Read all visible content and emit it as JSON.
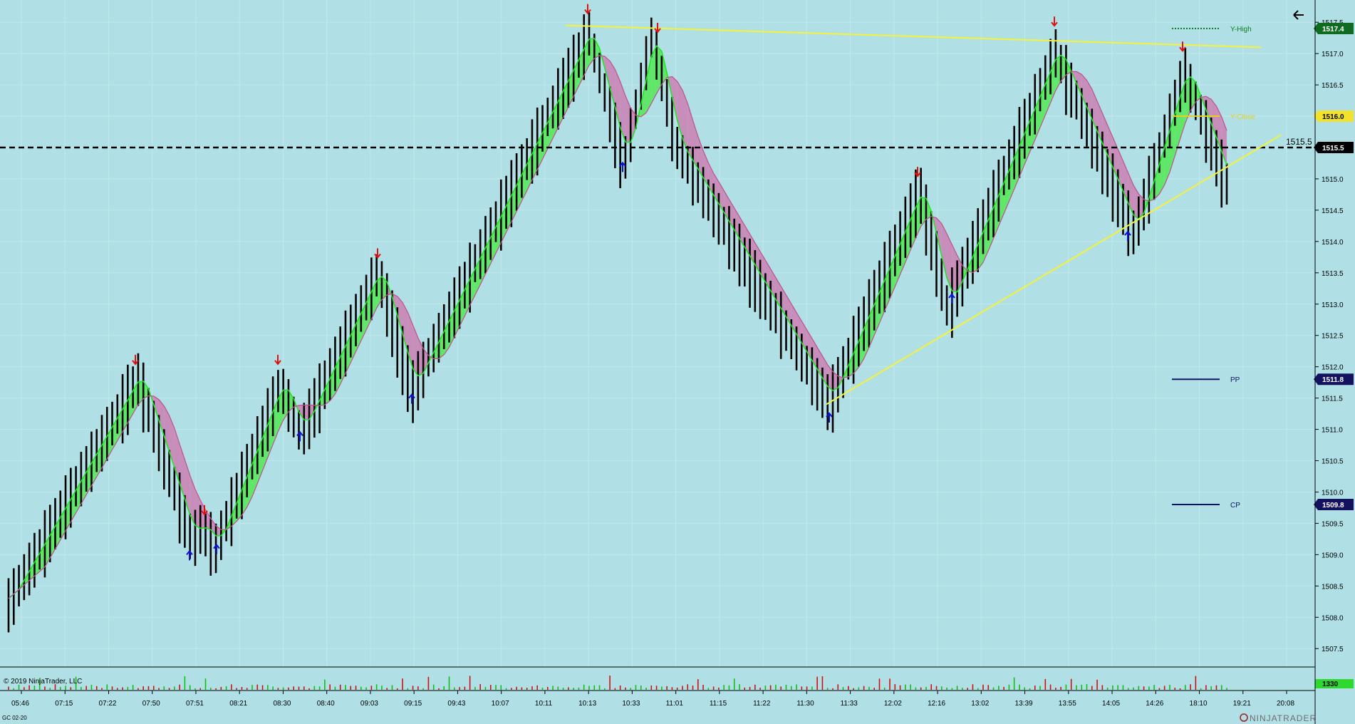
{
  "chart_data": {
    "type": "candlestick",
    "instrument": "GC 02-20",
    "copyright": "© 2019 NinjaTrader, LLC",
    "brand": "NINJATRADER",
    "ylim": [
      1507.2,
      1517.6
    ],
    "y_ticks": [
      "1507.5",
      "1508.0",
      "1508.5",
      "1509.0",
      "1509.5",
      "1510.0",
      "1510.5",
      "1511.0",
      "1511.5",
      "1512.0",
      "1512.5",
      "1513.0",
      "1513.5",
      "1514.0",
      "1514.5",
      "1515.0",
      "1515.5",
      "1516.0",
      "1516.5",
      "1517.0",
      "1517.5"
    ],
    "x_ticks": [
      "05:46",
      "07:15",
      "07:22",
      "07:50",
      "07:51",
      "08:21",
      "08:30",
      "08:40",
      "09:03",
      "09:15",
      "09:43",
      "10:07",
      "10:11",
      "10:13",
      "10:33",
      "11:01",
      "11:15",
      "11:22",
      "11:30",
      "11:33",
      "12:02",
      "12:16",
      "13:02",
      "13:39",
      "13:55",
      "14:05",
      "14:26",
      "18:10",
      "19:21",
      "20:08"
    ],
    "price_path": [
      [
        0,
        1508.3
      ],
      [
        150,
        1511.9
      ],
      [
        212,
        1509.3
      ],
      [
        222,
        1509.5
      ],
      [
        240,
        1509.2
      ],
      [
        315,
        1511.8
      ],
      [
        338,
        1511.0
      ],
      [
        428,
        1513.6
      ],
      [
        467,
        1511.7
      ],
      [
        672,
        1517.4
      ],
      [
        712,
        1515.3
      ],
      [
        745,
        1517.4
      ],
      [
        773,
        1515.6
      ],
      [
        950,
        1511.5
      ],
      [
        1055,
        1514.9
      ],
      [
        1087,
        1513.0
      ],
      [
        1212,
        1517.1
      ],
      [
        1303,
        1514.2
      ],
      [
        1361,
        1516.8
      ],
      [
        1410,
        1515.0
      ]
    ],
    "bar_count": 236,
    "current_price": "1515.5",
    "price_tags": [
      {
        "label": "1517.4",
        "value": 1517.4,
        "bg": "#0f6b1f",
        "fg": "#ffffff"
      },
      {
        "label": "1516.0",
        "value": 1516.0,
        "bg": "#f2e22e",
        "fg": "#000000"
      },
      {
        "label": "1515.5",
        "value": 1515.5,
        "bg": "#000000",
        "fg": "#ffffff"
      },
      {
        "label": "1511.8",
        "value": 1511.8,
        "bg": "#12125e",
        "fg": "#ffffff"
      },
      {
        "label": "1509.8",
        "value": 1509.8,
        "bg": "#12125e",
        "fg": "#ffffff"
      }
    ],
    "levels": [
      {
        "name": "Y-High",
        "value": 1517.4,
        "color": "#0f7a1f",
        "style": "dotted"
      },
      {
        "name": "Y-Close",
        "value": 1516.0,
        "color": "#e8d020",
        "style": "solid"
      },
      {
        "name": "PP",
        "value": 1511.8,
        "color": "#12125e",
        "style": "solid"
      },
      {
        "name": "CP",
        "value": 1509.8,
        "color": "#12125e",
        "style": "solid"
      }
    ],
    "trendlines": [
      {
        "color": "#f5f23a",
        "from": [
          794,
          1517.45
        ],
        "to": [
          1770,
          1517.1
        ]
      },
      {
        "color": "#f5f23a",
        "from": [
          1160,
          1511.4
        ],
        "to": [
          1798,
          1515.7
        ]
      }
    ],
    "down_arrows": [
      [
        190,
        1512.1
      ],
      [
        390,
        1512.1
      ],
      [
        530,
        1513.8
      ],
      [
        825,
        1517.7
      ],
      [
        923,
        1517.4
      ],
      [
        287,
        1509.7
      ],
      [
        1288,
        1515.1
      ],
      [
        1480,
        1517.5
      ],
      [
        1660,
        1517.1
      ]
    ],
    "up_arrows": [
      [
        266,
        1509.0
      ],
      [
        304,
        1509.1
      ],
      [
        421,
        1510.9
      ],
      [
        578,
        1511.5
      ],
      [
        874,
        1515.2
      ],
      [
        1164,
        1511.2
      ],
      [
        1336,
        1513.1
      ],
      [
        1583,
        1514.1
      ]
    ],
    "volume_bars": 236,
    "volume_tag": "1330",
    "colors": {
      "background": "#b0e0e6",
      "bar": "#000000",
      "band_up": "#1ee61e",
      "band_down": "#c0508e",
      "band_down_fill": "#cc7fb3",
      "band_up_fill": "#52e852",
      "arrow_down": "#e01010",
      "arrow_up": "#1010d0",
      "grid": "#c2e8ec"
    }
  }
}
